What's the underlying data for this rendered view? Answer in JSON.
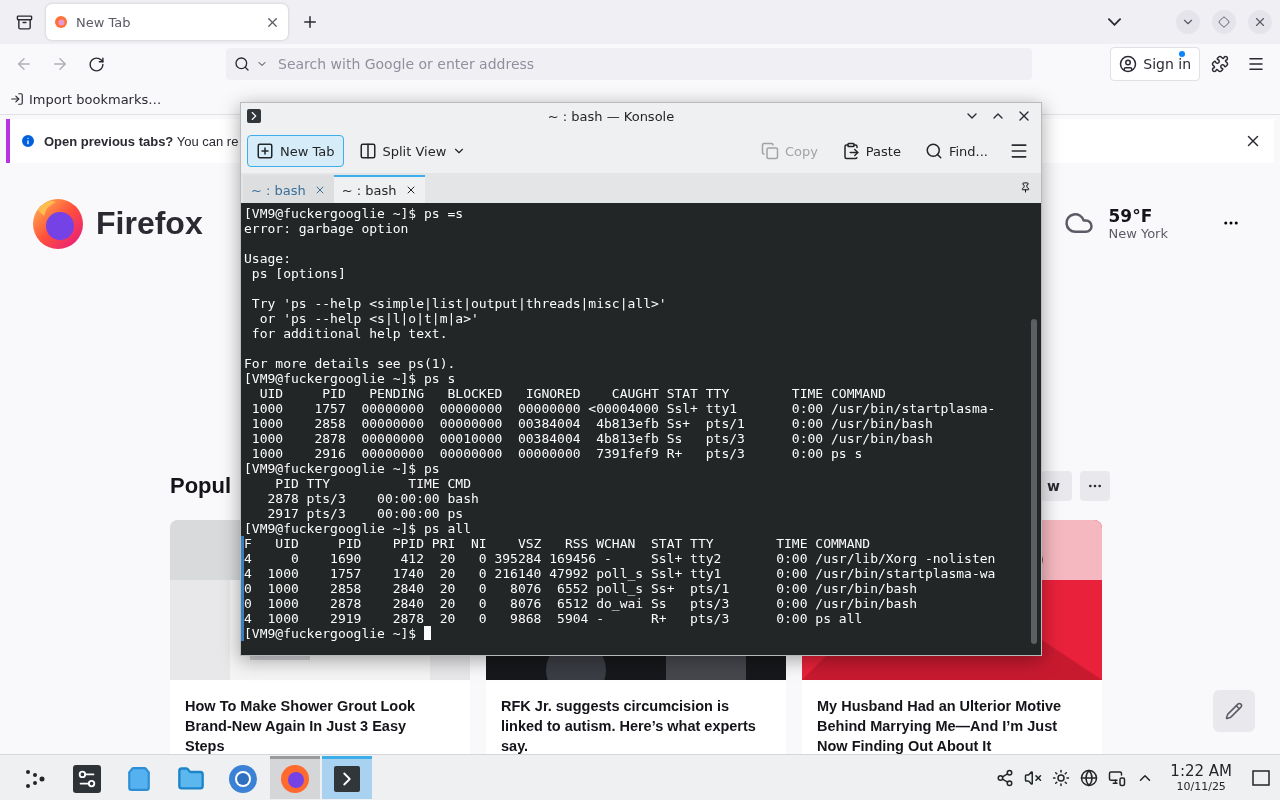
{
  "browser": {
    "tabs": [
      {
        "title": "New Tab",
        "selected": true
      }
    ],
    "address": {
      "placeholder": "Search with Google or enter address"
    },
    "account": {
      "label": "Sign in",
      "notification": true
    },
    "bookmarks": [
      "Import bookmarks…"
    ],
    "notice": {
      "title": "Open previous tabs?",
      "text": "You can re"
    },
    "brand": "Firefox",
    "weather": {
      "temperature": "59°F",
      "city": "New York"
    },
    "section": {
      "heading": "Popul",
      "button": "w"
    },
    "articles": [
      {
        "kind": "picture",
        "title": "How To Make Shower Grout Look Brand-New Again In Just 3 Easy Steps"
      },
      {
        "kind": "picture",
        "title": "RFK Jr. suggests circumcision is linked to autism. Here’s what experts say."
      },
      {
        "kind": "picture",
        "title": "My Husband Had an Ulterior Motive Behind Marrying Me—And I’m Just Now Finding Out About It"
      }
    ]
  },
  "konsole": {
    "title": "~ : bash — Konsole",
    "toolbar": [
      {
        "kind": "new-tab",
        "label": "New Tab",
        "hovered": true,
        "disabled": false
      },
      {
        "kind": "split",
        "label": "Split View",
        "hovered": false,
        "disabled": false
      },
      {
        "kind": "copy",
        "label": "Copy",
        "hovered": false,
        "disabled": true
      },
      {
        "kind": "paste",
        "label": "Paste",
        "hovered": false,
        "disabled": false
      },
      {
        "kind": "find",
        "label": "Find...",
        "hovered": false,
        "disabled": false
      }
    ],
    "tabs": [
      {
        "title": "~ : bash",
        "selected": false
      },
      {
        "title": "~ : bash",
        "selected": true
      }
    ],
    "lines": [
      {
        "kind": "text",
        "text": "[VM9@fuckergooglie ~]$ ps =s",
        "marked": false
      },
      {
        "kind": "text",
        "text": "error: garbage option",
        "marked": false
      },
      {
        "kind": "blank"
      },
      {
        "kind": "text",
        "text": "Usage:",
        "marked": false
      },
      {
        "kind": "text",
        "text": " ps [options]",
        "marked": false
      },
      {
        "kind": "blank"
      },
      {
        "kind": "text",
        "text": " Try 'ps --help <simple|list|output|threads|misc|all>'",
        "marked": false
      },
      {
        "kind": "text",
        "text": "  or 'ps --help <s|l|o|t|m|a>'",
        "marked": false
      },
      {
        "kind": "text",
        "text": " for additional help text.",
        "marked": false
      },
      {
        "kind": "blank"
      },
      {
        "kind": "text",
        "text": "For more details see ps(1).",
        "marked": false
      },
      {
        "kind": "text",
        "text": "[VM9@fuckergooglie ~]$ ps s",
        "marked": false
      },
      {
        "kind": "text",
        "text": "  UID     PID   PENDING   BLOCKED   IGNORED    CAUGHT STAT TTY        TIME COMMAND",
        "marked": false
      },
      {
        "kind": "text",
        "text": " 1000    1757  00000000  00000000  00000000 <00004000 Ssl+ tty1       0:00 /usr/bin/startplasma-",
        "marked": false
      },
      {
        "kind": "text",
        "text": " 1000    2858  00000000  00000000  00384004  4b813efb Ss+  pts/1      0:00 /usr/bin/bash",
        "marked": false
      },
      {
        "kind": "text",
        "text": " 1000    2878  00000000  00010000  00384004  4b813efb Ss   pts/3      0:00 /usr/bin/bash",
        "marked": false
      },
      {
        "kind": "text",
        "text": " 1000    2916  00000000  00000000  00000000  7391fef9 R+   pts/3      0:00 ps s",
        "marked": false
      },
      {
        "kind": "text",
        "text": "[VM9@fuckergooglie ~]$ ps",
        "marked": false
      },
      {
        "kind": "text",
        "text": "    PID TTY          TIME CMD",
        "marked": false
      },
      {
        "kind": "text",
        "text": "   2878 pts/3    00:00:00 bash",
        "marked": false
      },
      {
        "kind": "text",
        "text": "   2917 pts/3    00:00:00 ps",
        "marked": false
      },
      {
        "kind": "text",
        "text": "[VM9@fuckergooglie ~]$ ps all",
        "marked": false
      },
      {
        "kind": "text",
        "text": "F   UID     PID    PPID PRI  NI    VSZ   RSS WCHAN  STAT TTY        TIME COMMAND",
        "marked": true
      },
      {
        "kind": "text",
        "text": "4     0    1690     412  20   0 395284 169456 -     Ssl+ tty2       0:00 /usr/lib/Xorg -nolisten",
        "marked": true
      },
      {
        "kind": "text",
        "text": "4  1000    1757    1740  20   0 216140 47992 poll_s Ssl+ tty1       0:00 /usr/bin/startplasma-wa",
        "marked": true
      },
      {
        "kind": "text",
        "text": "0  1000    2858    2840  20   0   8076  6552 poll_s Ss+  pts/1      0:00 /usr/bin/bash",
        "marked": true
      },
      {
        "kind": "text",
        "text": "0  1000    2878    2840  20   0   8076  6512 do_wai Ss   pts/3      0:00 /usr/bin/bash",
        "marked": true
      },
      {
        "kind": "text",
        "text": "4  1000    2919    2878  20   0   9868  5904 -      R+   pts/3      0:00 ps all",
        "marked": true
      },
      {
        "kind": "prompt",
        "text": "[VM9@fuckergooglie ~]$ ",
        "marked": true,
        "cursor": true
      }
    ]
  },
  "taskbar": {
    "apps": [
      {
        "kind": "launcher",
        "open": false,
        "selected": false
      },
      {
        "kind": "settings",
        "open": false,
        "selected": false
      },
      {
        "kind": "store",
        "open": false,
        "selected": false
      },
      {
        "kind": "files",
        "open": false,
        "selected": false
      },
      {
        "kind": "chromium",
        "open": false,
        "selected": false
      },
      {
        "kind": "firefox",
        "open": true,
        "selected": false
      },
      {
        "kind": "konsole",
        "open": true,
        "selected": true
      }
    ],
    "tray": [
      {
        "kind": "connect"
      },
      {
        "kind": "mute"
      },
      {
        "kind": "brightness"
      },
      {
        "kind": "globe"
      },
      {
        "kind": "network"
      },
      {
        "kind": "expand"
      }
    ],
    "time": "1:22 AM",
    "date": "10/11/25"
  }
}
